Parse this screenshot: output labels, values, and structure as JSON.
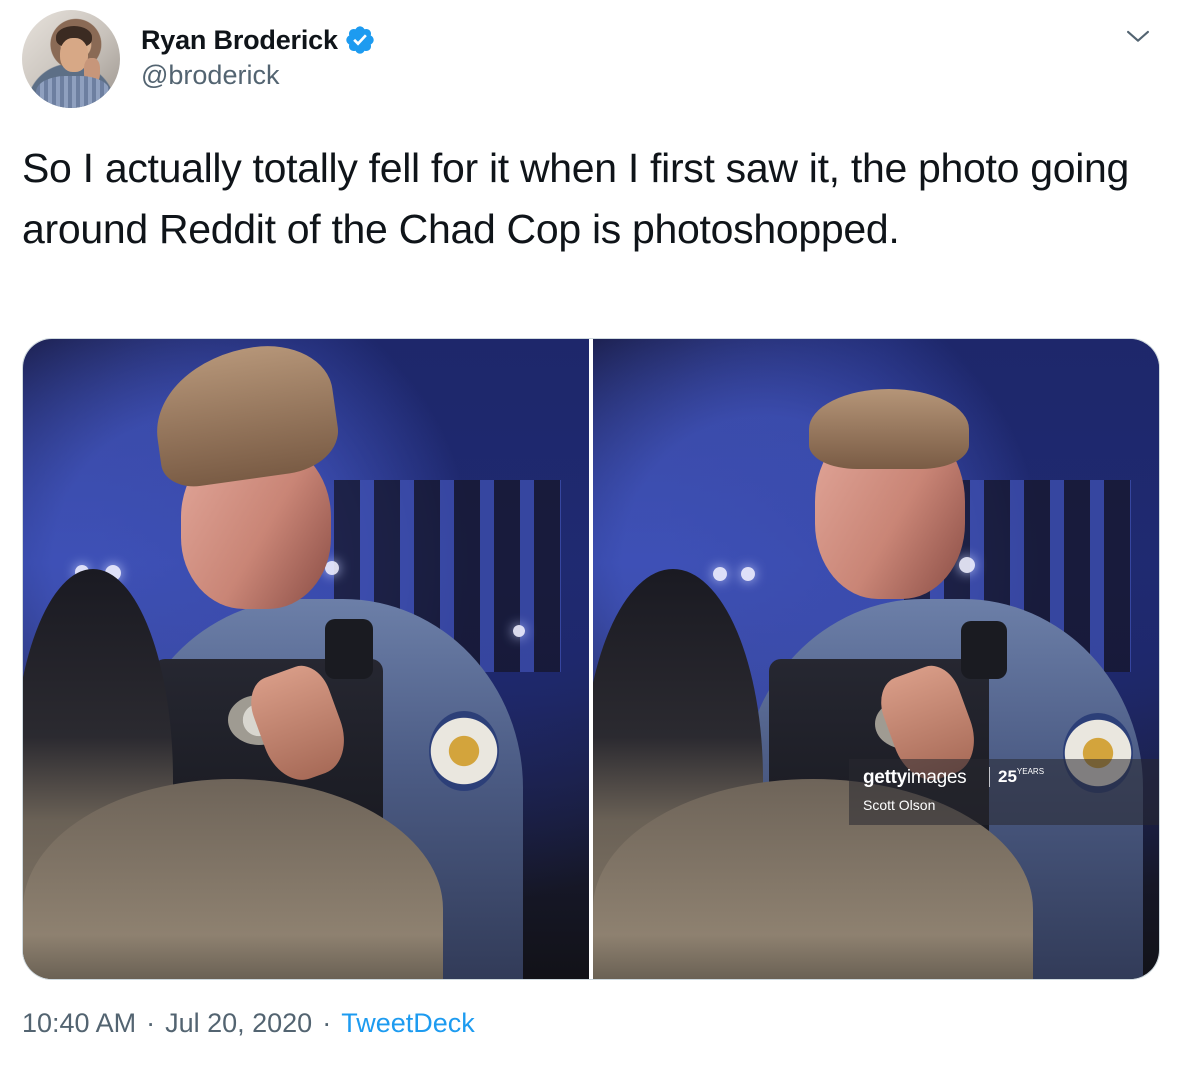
{
  "author": {
    "display_name": "Ryan Broderick",
    "handle": "@broderick",
    "verified": true
  },
  "tweet": {
    "text": "So I actually totally fell for it when I first saw it, the photo going around Reddit of the Chad Cop is photoshopped."
  },
  "media": {
    "watermark": {
      "brand_bold": "getty",
      "brand_light": "images",
      "years": "25",
      "years_label": "YEARS",
      "credit": "Scott Olson"
    }
  },
  "meta": {
    "time": "10:40 AM",
    "date": "Jul 20, 2020",
    "separator": "·",
    "source": "TweetDeck"
  },
  "colors": {
    "accent": "#1d9bf0",
    "secondary_text": "#536471",
    "primary_text": "#0f1419"
  },
  "icons": {
    "verified": "verified-badge-icon",
    "menu": "chevron-down-icon"
  }
}
